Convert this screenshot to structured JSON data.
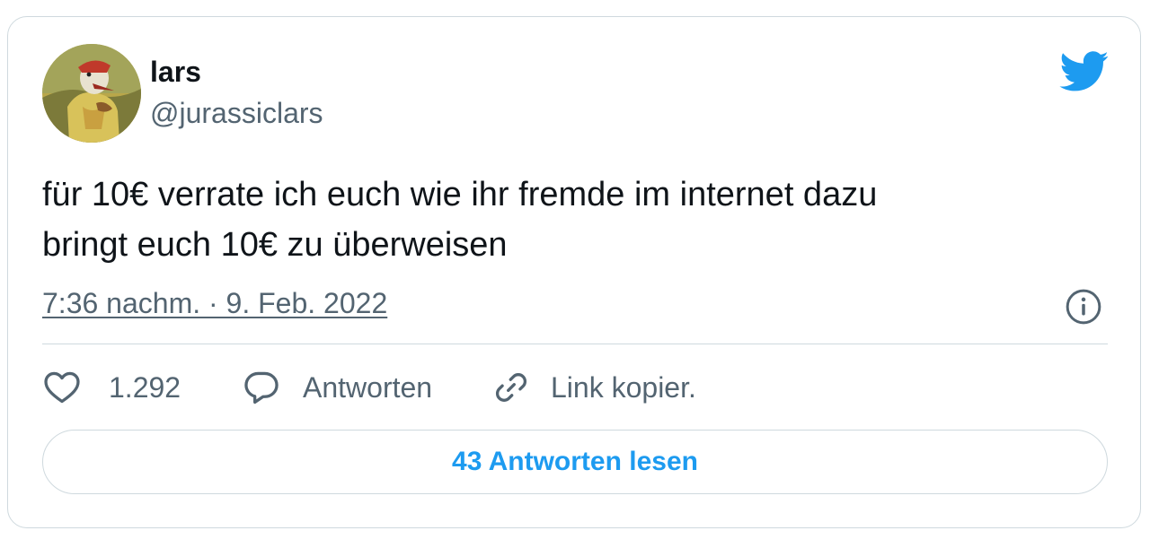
{
  "author": {
    "display_name": "lars",
    "handle": "@jurassiclars",
    "avatar_icon": "dinosaur-portrait-avatar"
  },
  "brand": {
    "logo_icon": "twitter-bird-icon",
    "accent_color": "#1d9bf0"
  },
  "tweet": {
    "text_line1": "für 10€ verrate ich euch wie ihr fremde im internet dazu",
    "text_line2": "bringt euch 10€ zu überweisen",
    "timestamp": "7:36 nachm. · 9. Feb. 2022"
  },
  "actions": {
    "like_icon": "heart-icon",
    "like_count": "1.292",
    "reply_icon": "speech-bubble-icon",
    "reply_label": "Antworten",
    "copy_icon": "link-icon",
    "copy_label": "Link kopier."
  },
  "footer": {
    "read_replies_label": "43 Antworten lesen"
  },
  "colors": {
    "text_primary": "#0f1419",
    "text_secondary": "#536471",
    "border": "#cfd9de"
  }
}
